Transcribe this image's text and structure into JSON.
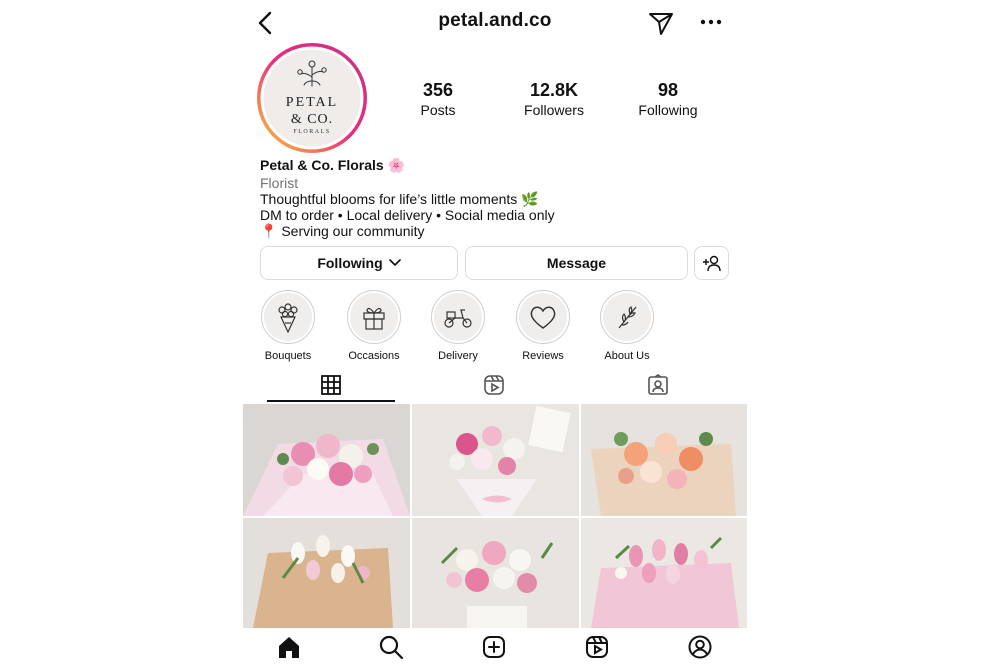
{
  "header": {
    "username": "petal.and.co"
  },
  "profile": {
    "logo_text_1": "PETAL",
    "logo_text_2": "& CO.",
    "logo_text_3": "FLORALS",
    "display_name": "Petal & Co. Florals",
    "display_emoji": "🌸",
    "category": "Florist",
    "bio_line_1": "Thoughtful blooms for life’s little moments",
    "bio_line_1_emoji": "🌿",
    "bio_line_2": "DM to order • Local delivery • Social media only",
    "bio_line_3_emoji": "📍",
    "bio_line_3": "Serving our community"
  },
  "stats": [
    {
      "value": "356",
      "label": "Posts"
    },
    {
      "value": "12.8K",
      "label": "Followers"
    },
    {
      "value": "98",
      "label": "Following"
    }
  ],
  "actions": {
    "following_label": "Following",
    "message_label": "Message"
  },
  "highlights": [
    {
      "label": "Bouquets",
      "icon": "bouquet-icon"
    },
    {
      "label": "Occasions",
      "icon": "gift-icon"
    },
    {
      "label": "Delivery",
      "icon": "scooter-icon"
    },
    {
      "label": "Reviews",
      "icon": "heart-icon"
    },
    {
      "label": "About Us",
      "icon": "leaf-icon"
    }
  ],
  "tabs": [
    "grid-icon",
    "reels-icon",
    "tagged-icon"
  ],
  "nav": [
    "home-icon",
    "search-icon",
    "create-icon",
    "reels-icon",
    "profile-icon"
  ],
  "colors": {
    "story_ring_start": "#f9ce34",
    "story_ring_mid": "#ee2a7b",
    "story_ring_end": "#c13584",
    "border": "#dbdbdb",
    "muted": "#737373"
  }
}
